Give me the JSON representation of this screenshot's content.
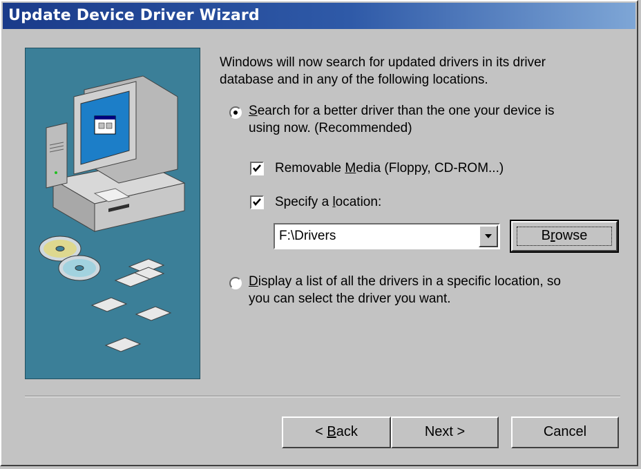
{
  "window": {
    "title": "Update Device Driver Wizard"
  },
  "intro": {
    "line1": "Windows will now search for updated drivers in its driver",
    "line2": "database and in any of the following locations."
  },
  "option_search": {
    "selected": true,
    "line1_hotkey": "S",
    "line1_rest": "earch for a better driver than the one your device is",
    "line2": "using now. (Recommended)"
  },
  "removable_media": {
    "checked": true,
    "pre": "Removable ",
    "hotkey": "M",
    "post": "edia (Floppy, CD-ROM...)"
  },
  "specify_location": {
    "checked": true,
    "pre": "Specify a ",
    "hotkey": "l",
    "post": "ocation:"
  },
  "location_combo": {
    "value": "F:\\Drivers"
  },
  "browse_button": {
    "pre": "B",
    "hotkey": "r",
    "post": "owse"
  },
  "option_list": {
    "selected": false,
    "line1_hotkey": "D",
    "line1_rest": "isplay a list of all the drivers in a specific location, so",
    "line2": "you can select the driver you want."
  },
  "footer": {
    "back_pre": "< ",
    "back_hotkey": "B",
    "back_post": "ack",
    "next_label": "Next >",
    "cancel_label": "Cancel"
  },
  "colors": {
    "titlebar_start": "#1a3b8a",
    "titlebar_end": "#7ea6d6",
    "art_bg": "#3b7f98",
    "face": "#c3c3c3"
  },
  "icons": [
    "computer-illustration",
    "cd-rom-icon",
    "floppy-disk-icon"
  ]
}
